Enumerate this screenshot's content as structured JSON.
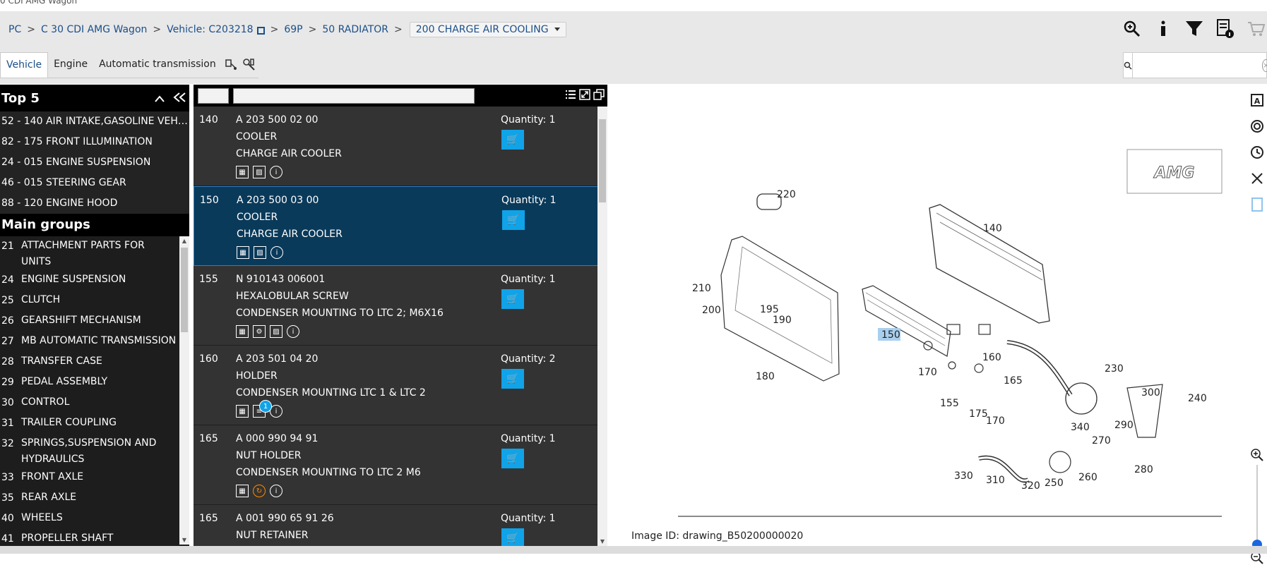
{
  "window": {
    "title_fragment": "0 CDI AMG Wagon"
  },
  "breadcrumb": {
    "items": [
      "PC",
      "C 30 CDI AMG Wagon",
      "Vehicle: C203218",
      "69P",
      "50 RADIATOR"
    ],
    "current": "200 CHARGE AIR COOLING",
    "separator": ">"
  },
  "tabs": [
    {
      "label": "Vehicle",
      "active": true
    },
    {
      "label": "Engine",
      "active": false
    },
    {
      "label": "Automatic transmission",
      "active": false
    }
  ],
  "search": {
    "placeholder": "",
    "value": ""
  },
  "top5": {
    "title": "Top 5",
    "items": [
      "52 - 140 AIR INTAKE,GASOLINE VEHIC...",
      "82 - 175 FRONT ILLUMINATION",
      "24 - 015 ENGINE SUSPENSION",
      "46 - 015 STEERING GEAR",
      "88 - 120 ENGINE HOOD"
    ]
  },
  "main_groups": {
    "title": "Main groups",
    "items": [
      {
        "num": "21",
        "label": "ATTACHMENT PARTS FOR UNITS"
      },
      {
        "num": "24",
        "label": "ENGINE SUSPENSION"
      },
      {
        "num": "25",
        "label": "CLUTCH"
      },
      {
        "num": "26",
        "label": "GEARSHIFT MECHANISM"
      },
      {
        "num": "27",
        "label": "MB AUTOMATIC TRANSMISSION"
      },
      {
        "num": "28",
        "label": "TRANSFER CASE"
      },
      {
        "num": "29",
        "label": "PEDAL ASSEMBLY"
      },
      {
        "num": "30",
        "label": "CONTROL"
      },
      {
        "num": "31",
        "label": "TRAILER COUPLING"
      },
      {
        "num": "32",
        "label": "SPRINGS,SUSPENSION AND HYDRAULICS"
      },
      {
        "num": "33",
        "label": "FRONT AXLE"
      },
      {
        "num": "35",
        "label": "REAR AXLE"
      },
      {
        "num": "40",
        "label": "WHEELS"
      },
      {
        "num": "41",
        "label": "PROPELLER SHAFT"
      }
    ]
  },
  "parts": [
    {
      "pos": "140",
      "number": "A 203 500 02 00",
      "name": "COOLER",
      "desc": "CHARGE AIR COOLER",
      "qty": "Quantity: 1",
      "selected": false,
      "icons": [
        "table",
        "image",
        "info"
      ]
    },
    {
      "pos": "150",
      "number": "A 203 500 03 00",
      "name": "COOLER",
      "desc": "CHARGE AIR COOLER",
      "qty": "Quantity: 1",
      "selected": true,
      "icons": [
        "table",
        "image",
        "info"
      ]
    },
    {
      "pos": "155",
      "number": "N 910143 006001",
      "name": "HEXALOBULAR SCREW",
      "desc": "CONDENSER MOUNTING TO LTC 2; M6X16",
      "qty": "Quantity: 1",
      "selected": false,
      "icons": [
        "table",
        "wrench",
        "image",
        "info"
      ]
    },
    {
      "pos": "160",
      "number": "A 203 501 04 20",
      "name": "HOLDER",
      "desc": "CONDENSER MOUNTING LTC 1 & LTC 2",
      "qty": "Quantity: 2",
      "selected": false,
      "icons": [
        "table",
        "doc",
        "info"
      ],
      "badge": "1"
    },
    {
      "pos": "165",
      "number": "A 000 990 94 91",
      "name": "NUT HOLDER",
      "desc": "CONDENSER MOUNTING TO LTC 2 M6",
      "qty": "Quantity: 1",
      "selected": false,
      "icons": [
        "table",
        "refresh",
        "info"
      ]
    },
    {
      "pos": "165",
      "number": "A 001 990 65 91 26",
      "name": "NUT RETAINER",
      "desc": "",
      "qty": "Quantity: 1",
      "selected": false,
      "icons": []
    }
  ],
  "drawing": {
    "image_id": "Image ID: drawing_B50200000020",
    "logo": "AMG",
    "callouts": [
      "220",
      "140",
      "210",
      "200",
      "195",
      "190",
      "150",
      "160",
      "170",
      "165",
      "230",
      "180",
      "155",
      "175",
      "170",
      "340",
      "300",
      "240",
      "290",
      "270",
      "330",
      "310",
      "320",
      "250",
      "260",
      "280"
    ]
  },
  "colors": {
    "accent": "#10a3e8",
    "selected_row": "#0a3a5a",
    "link": "#1b4f8a"
  }
}
